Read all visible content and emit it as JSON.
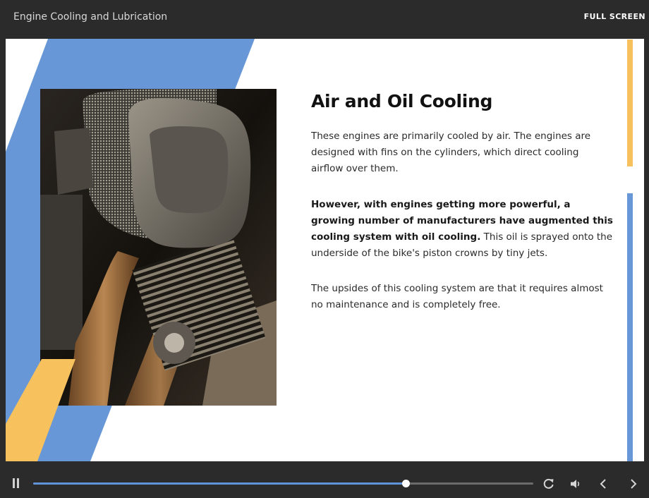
{
  "header": {
    "course_title": "Engine Cooling and Lubrication",
    "fullscreen_label": "FULL SCREEN"
  },
  "slide": {
    "heading": "Air and Oil Cooling",
    "paragraph1": "These engines are primarily cooled by air. The engines are designed with fins on the cylinders, which direct cooling airflow over them.",
    "paragraph2_bold": "However, with engines getting more powerful, a growing number of manufacturers have augmented this cooling system with oil cooling.",
    "paragraph2_rest": " This oil is sprayed onto the underside of the bike's piston crowns by tiny jets.",
    "paragraph3": "The upsides of this cooling system are that it requires almost no maintenance and is completely free.",
    "image_subject": "motorcycle engine with air filter and cooling fins"
  },
  "player": {
    "progress": 0.745,
    "icons": {
      "pause": "pause-icon",
      "replay": "replay-icon",
      "volume": "volume-icon",
      "previous": "chevron-left-icon",
      "next": "chevron-right-icon"
    }
  },
  "colors": {
    "accent_blue": "#6797d6",
    "accent_yellow": "#f7c15e",
    "chrome_dark": "#2b2b2b"
  }
}
